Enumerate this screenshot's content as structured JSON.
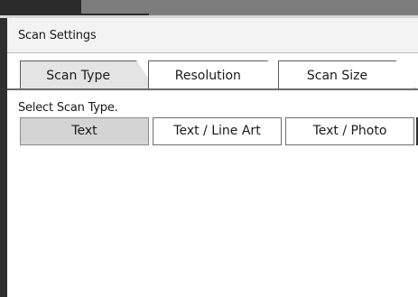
{
  "window": {
    "title": "Scan Settings"
  },
  "tabs": [
    {
      "label": "Scan Type",
      "selected": true
    },
    {
      "label": "Resolution",
      "selected": false
    },
    {
      "label": "Scan Size",
      "selected": false
    }
  ],
  "prompt": "Select Scan Type.",
  "scan_types": [
    {
      "label": "Text",
      "selected": true
    },
    {
      "label": "Text / Line Art",
      "selected": false
    },
    {
      "label": "Text / Photo",
      "selected": false
    }
  ],
  "colors": {
    "selected_tab": "#e4e4e4",
    "selected_button": "#d4d4d4",
    "frame_dark": "#2e2e2e"
  }
}
